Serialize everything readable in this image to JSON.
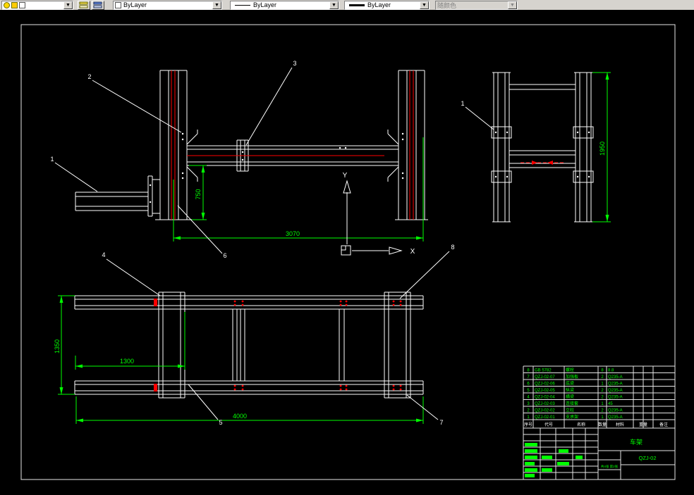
{
  "toolbar": {
    "color": {
      "value": "ByLayer"
    },
    "linetype": {
      "value": "ByLayer"
    },
    "lineweight": {
      "value": "ByLayer"
    },
    "plot_style": {
      "value": "随颜色"
    },
    "dropdown_arrow": "▼"
  },
  "drawing": {
    "ucs": {
      "x": "X",
      "y": "Y"
    },
    "dims": {
      "front_width": "3070",
      "front_height": "750",
      "side_height": "1950",
      "plan_depth": "1350",
      "plan_offset": "1300",
      "plan_length": "4000"
    },
    "callouts": {
      "c1": "1",
      "c1_side": "1",
      "c2": "2",
      "c3": "3",
      "c4": "4",
      "c5": "5",
      "c6": "6",
      "c7": "7",
      "c8": "8"
    },
    "title_block": {
      "header": [
        "序号",
        "代号",
        "名称",
        "数量",
        "材料",
        "重量",
        "备注"
      ],
      "rows": [
        [
          "8",
          "GB 5782",
          "螺栓",
          "8",
          "8.8"
        ],
        [
          "7",
          "QZJ-02-07",
          "加强板",
          "2",
          "Q235-A"
        ],
        [
          "6",
          "QZJ-02-06",
          "底梁",
          "1",
          "Q235-A"
        ],
        [
          "5",
          "QZJ-02-05",
          "纵梁",
          "2",
          "Q235-A"
        ],
        [
          "4",
          "QZJ-02-04",
          "横梁",
          "2",
          "Q235-A"
        ],
        [
          "3",
          "QZJ-02-03",
          "连接套",
          "1",
          "45"
        ],
        [
          "2",
          "QZJ-02-02",
          "立柱",
          "2",
          "Q235-A"
        ],
        [
          "1",
          "QZJ-02-01",
          "支承架",
          "1",
          "Q235-A"
        ]
      ],
      "title": "车架",
      "drawing_no": "QZJ-02",
      "sheet": "共4张 第2张"
    }
  },
  "colors": {
    "line": "#ffffff",
    "dimension": "#00ff00",
    "centerline": "#ff0000",
    "background": "#000000",
    "toolbar_bg": "#d6d3ce"
  }
}
